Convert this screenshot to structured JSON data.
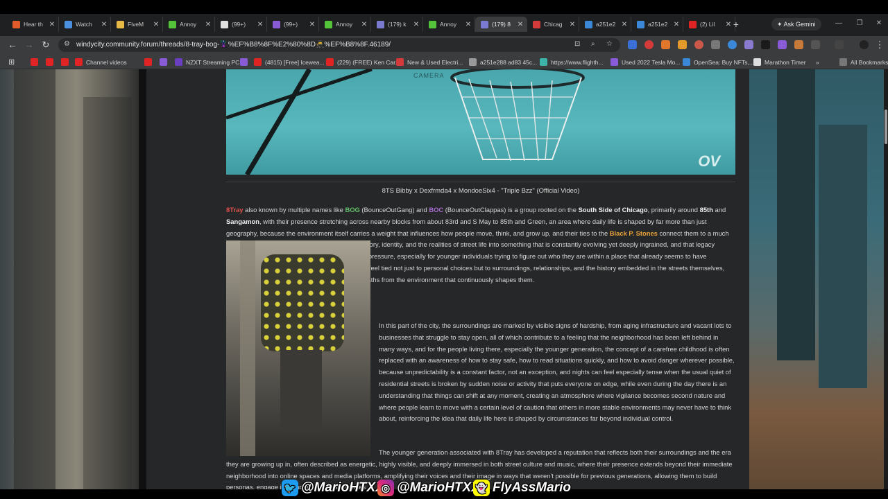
{
  "tabs": [
    {
      "label": "Hear th",
      "color": "#e25c2b"
    },
    {
      "label": "Watch",
      "color": "#4a8fe0"
    },
    {
      "label": "FiveM",
      "color": "#e6b845"
    },
    {
      "label": "Annoy",
      "color": "#53c43a"
    },
    {
      "label": "(99+)",
      "color": "#e0e0e0"
    },
    {
      "label": "(99+)",
      "color": "#8a5bd6"
    },
    {
      "label": "Annoy",
      "color": "#53c43a"
    },
    {
      "label": "(179) k",
      "color": "#7a7ad0"
    },
    {
      "label": "Annoy",
      "color": "#53c43a"
    },
    {
      "label": "(179) 8",
      "color": "#7a7ad0",
      "active": true
    },
    {
      "label": "Chicag",
      "color": "#d33a3a"
    },
    {
      "label": "a251e2",
      "color": "#3b88d8"
    },
    {
      "label": "a251e2",
      "color": "#3b88d8"
    },
    {
      "label": "(2) Lil",
      "color": "#e02424"
    }
  ],
  "gemini_label": "Ask Gemini",
  "url": "windycity.community.forum/threads/8-tray-bog-🦹%EF%B8%8F%E2%80%8D🥷%EF%B8%8F.46189/",
  "bookmarks": [
    {
      "label": "",
      "color": "#e02424"
    },
    {
      "label": "",
      "color": "#e02424"
    },
    {
      "label": "",
      "color": "#e02424"
    },
    {
      "label": "Channel videos",
      "color": "#e02424"
    },
    {
      "label": "",
      "color": "#e02424"
    },
    {
      "label": "",
      "color": "#8a5bd6"
    },
    {
      "label": "NZXT Streaming PC",
      "color": "#6a3fbf"
    },
    {
      "label": "",
      "color": "#8a5bd6"
    },
    {
      "label": "(4815) [Free] Icewea...",
      "color": "#e02424"
    },
    {
      "label": "(229) (FREE) Ken Car...",
      "color": "#e02424"
    },
    {
      "label": "New & Used Electri...",
      "color": "#d33a3a"
    },
    {
      "label": "a251e288 ad83 45c...",
      "color": "#999999"
    },
    {
      "label": "https://www.flighth...",
      "color": "#3bb3a8"
    },
    {
      "label": "Used 2022 Tesla Mo...",
      "color": "#8a5bd6"
    },
    {
      "label": "OpenSea: Buy NFTs,...",
      "color": "#3b88d8"
    },
    {
      "label": "Marathon Timer",
      "color": "#dddddd"
    }
  ],
  "all_bookmarks": "All Bookmarks",
  "hero": {
    "watermark": "OV",
    "camera_text": "CAMERA"
  },
  "caption": "8TS Bibby x Dexfrmda4 x MondoeSix4 - \"Triple Bzz\" (Official Video)",
  "para1": {
    "k1": "8Tray",
    "t1": " also known by multiple names like ",
    "k2": "BOG",
    "t2": " (BounceOutGang) and ",
    "k3": "BOC",
    "t3": " (BounceOutClappas) is a group rooted on the ",
    "k4": "South Side of Chicago",
    "t4": ", primarily around ",
    "k5": "85th",
    "t5": " and ",
    "k6": "Sangamon",
    "t6": ", with their presence stretching across nearby blocks from about 83rd and S May to 85th and Green, an area where daily life is shaped by far more than just geography, because the environment itself carries a weight that influences how people move, think, and grow up, and their ties to the ",
    "k7": "Black P. Stones",
    "t7": " connect them to a much broader legacy within the city, one that blends history, identity, and the realities of street life into something that is constantly evolving yet deeply ingrained, and that legacy carries both a sense of belonging and a sense of pressure, especially for younger individuals trying to figure out who they are within a place that already seems to have expectations laid out for them, where identity can feel tied not just to personal choices but to surroundings, relationships, and the history embedded in the streets themselves, making it difficult at times to separate individual paths from the environment that continuously shapes them."
  },
  "para2": "In this part of the city, the surroundings are marked by visible signs of hardship, from aging infrastructure and vacant lots to businesses that struggle to stay open, all of which contribute to a feeling that the neighborhood has been left behind in many ways, and for the people living there, especially the younger generation, the concept of a carefree childhood is often replaced with an awareness of how to stay safe, how to read situations quickly, and how to avoid danger wherever possible, because unpredictability is a constant factor, not an exception, and nights can feel especially tense when the usual quiet of residential streets is broken by sudden noise or activity that puts everyone on edge, while even during the day there is an understanding that things can shift at any moment, creating an atmosphere where vigilance becomes second nature and where people learn to move with a certain level of caution that others in more stable environments may never have to think about, reinforcing the idea that daily life here is shaped by circumstances far beyond individual control.",
  "para3": "The younger generation associated with 8Tray has developed a reputation that reflects both their surroundings and the era they are growing up in, often described as energetic, highly visible, and deeply immersed in both street culture and music, where their presence extends beyond their immediate neighborhood into online spaces and media platforms, amplifying their voices and their image in ways that weren't possible for previous generations, allowing them to build personas, engage in competitive and sometimes",
  "overlay": {
    "twitter": "@MarioHTXX",
    "instagram": "@MarioHTXX",
    "snapchat": "FlyAssMario"
  }
}
